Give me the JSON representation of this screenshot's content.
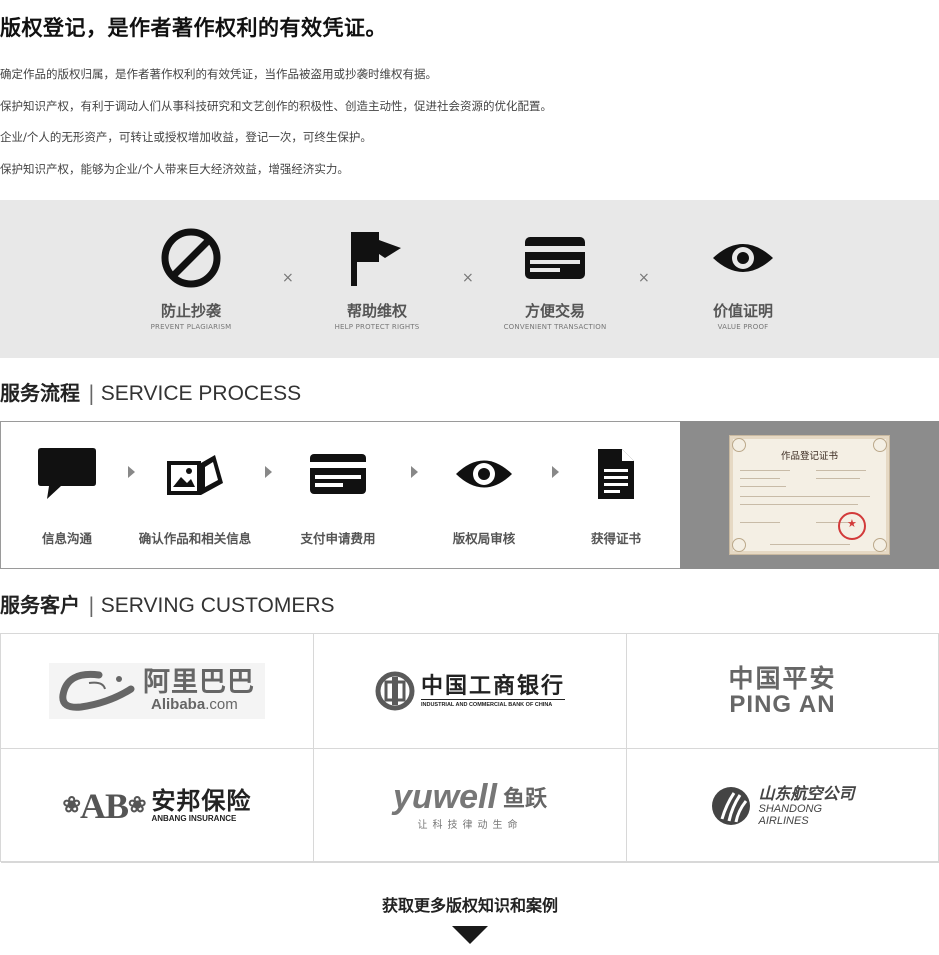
{
  "title": "版权登记，是作者著作权利的有效凭证。",
  "bullets": [
    "确定作品的版权归属，是作者著作权利的有效凭证，当作品被盗用或抄袭时维权有据。",
    "保护知识产权，有利于调动人们从事科技研究和文艺创作的积极性、创造主动性，促进社会资源的优化配置。",
    "企业/个人的无形资产，可转让或授权增加收益，登记一次，可终生保护。",
    "保护知识产权，能够为企业/个人带来巨大经济效益，增强经济实力。"
  ],
  "values": [
    {
      "name": "防止抄袭",
      "sub": "PREVENT PLAGIARISM",
      "icon": "prohibited-icon"
    },
    {
      "name": "帮助维权",
      "sub": "HELP PROTECT RIGHTS",
      "icon": "flag-icon"
    },
    {
      "name": "方便交易",
      "sub": "CONVENIENT TRANSACTION",
      "icon": "card-icon"
    },
    {
      "name": "价值证明",
      "sub": "VALUE PROOF",
      "icon": "eye-icon"
    }
  ],
  "value_separator": "×",
  "process": {
    "title_zh": "服务流程",
    "divider": "|",
    "title_en": "SERVICE PROCESS",
    "steps": [
      {
        "label": "信息沟通",
        "icon": "chat-icon"
      },
      {
        "label": "确认作品和相关信息",
        "icon": "photos-icon"
      },
      {
        "label": "支付申请费用",
        "icon": "card-icon"
      },
      {
        "label": "版权局审核",
        "icon": "eye-icon"
      },
      {
        "label": "获得证书",
        "icon": "document-icon"
      }
    ],
    "certificate_title": "作品登记证书"
  },
  "customers": {
    "title_zh": "服务客户",
    "divider": "|",
    "title_en": "SERVING CUSTOMERS",
    "logos": [
      {
        "zh": "阿里巴巴",
        "en": "Alibaba",
        "en_suffix": ".com",
        "icon": "alibaba-logo-icon"
      },
      {
        "zh": "中国工商银行",
        "en": "INDUSTRIAL AND COMMERCIAL BANK OF CHINA",
        "icon": "icbc-logo-icon"
      },
      {
        "zh": "中国平安",
        "en": "PING AN",
        "icon": "pingan-logo-icon"
      },
      {
        "zh": "安邦保险",
        "en": "ANBANG INSURANCE",
        "mark": "AB",
        "icon": "anbang-logo-icon"
      },
      {
        "zh": "鱼跃",
        "en": "yuwell",
        "tagline": "让科技律动生命",
        "icon": "yuwell-logo-icon"
      },
      {
        "zh": "山东航空公司",
        "en1": "SHANDONG",
        "en2": "AIRLINES",
        "icon": "shandong-airlines-logo-icon"
      }
    ]
  },
  "more": {
    "label": "获取更多版权知识和案例"
  },
  "colors": {
    "band": "#e8e8e8",
    "panel": "#8c8c8c",
    "icon": "#111111",
    "seal": "#d23a3a",
    "icbc": "#5a5a5a"
  }
}
